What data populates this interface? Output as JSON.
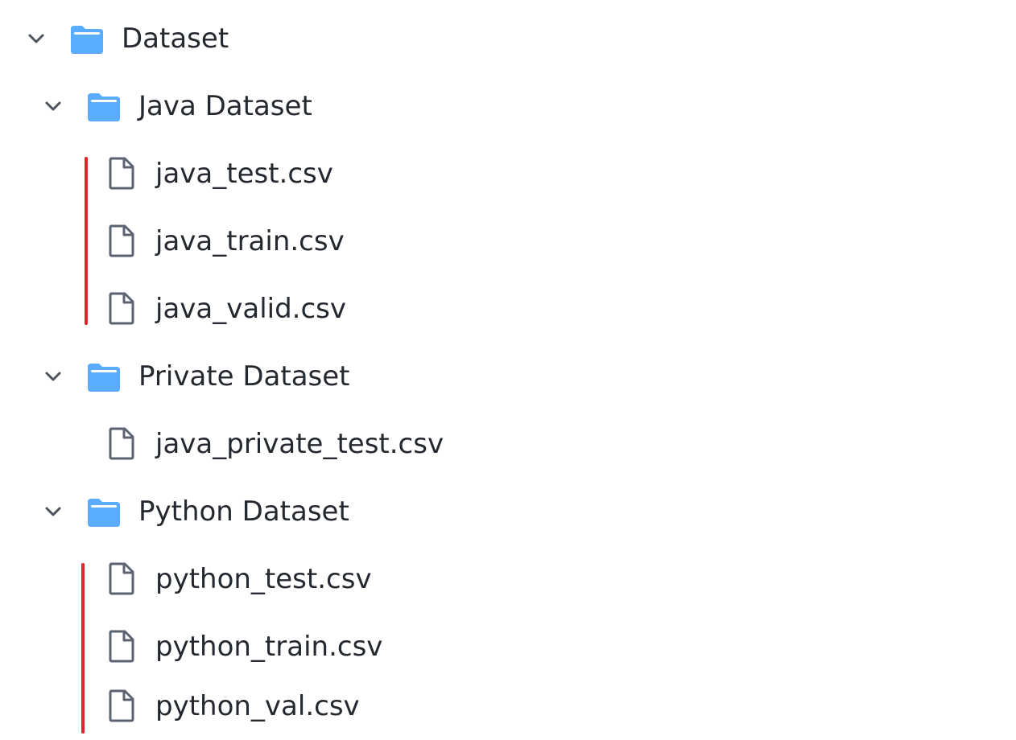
{
  "tree": {
    "root": {
      "label": "Dataset",
      "expanded": true,
      "icon": "folder-icon",
      "children": [
        {
          "label": "Java Dataset",
          "expanded": true,
          "icon": "folder-icon",
          "files": [
            "java_test.csv",
            "java_train.csv",
            "java_valid.csv"
          ]
        },
        {
          "label": "Private Dataset",
          "expanded": true,
          "icon": "folder-icon",
          "files": [
            "java_private_test.csv"
          ]
        },
        {
          "label": "Python Dataset",
          "expanded": true,
          "icon": "folder-icon",
          "files": [
            "python_test.csv",
            "python_train.csv",
            "python_val.csv"
          ]
        }
      ]
    }
  },
  "colors": {
    "folder": "#5aacff",
    "file_icon": "#5b6270",
    "chevron": "#4b535e",
    "guide_line": "#e0252b",
    "text": "#24292f"
  }
}
